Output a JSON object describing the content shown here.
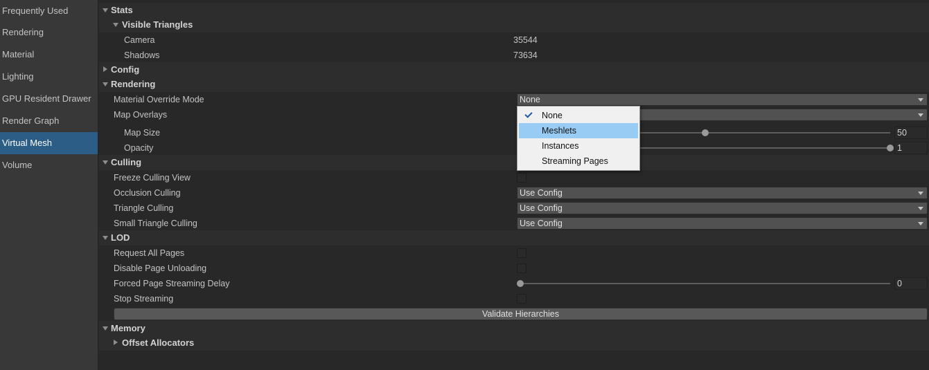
{
  "sidebar": {
    "items": [
      {
        "label": "Frequently Used"
      },
      {
        "label": "Rendering"
      },
      {
        "label": "Material"
      },
      {
        "label": "Lighting"
      },
      {
        "label": "GPU Resident Drawer"
      },
      {
        "label": "Render Graph"
      },
      {
        "label": "Virtual Mesh",
        "selected": true
      },
      {
        "label": "Volume"
      }
    ]
  },
  "stats": {
    "title": "Stats",
    "visible_triangles": {
      "title": "Visible Triangles",
      "camera_label": "Camera",
      "camera_value": "35544",
      "shadows_label": "Shadows",
      "shadows_value": "73634"
    }
  },
  "config": {
    "title": "Config"
  },
  "rendering": {
    "title": "Rendering",
    "material_override_mode": {
      "label": "Material Override Mode",
      "value": "None"
    },
    "map_overlays": {
      "label": "Map Overlays",
      "value": ""
    },
    "map_size": {
      "label": "Map Size",
      "value": "50",
      "fraction": 0.5
    },
    "opacity": {
      "label": "Opacity",
      "value": "1",
      "fraction": 1.0
    }
  },
  "culling": {
    "title": "Culling",
    "freeze_culling_view": {
      "label": "Freeze Culling View",
      "checked": false
    },
    "occlusion_culling": {
      "label": "Occlusion Culling",
      "value": "Use Config"
    },
    "triangle_culling": {
      "label": "Triangle Culling",
      "value": "Use Config"
    },
    "small_triangle_culling": {
      "label": "Small Triangle Culling",
      "value": "Use Config"
    }
  },
  "lod": {
    "title": "LOD",
    "request_all_pages": {
      "label": "Request All Pages",
      "checked": false
    },
    "disable_page_unloading": {
      "label": "Disable Page Unloading",
      "checked": false
    },
    "forced_page_streaming_delay": {
      "label": "Forced Page Streaming Delay",
      "value": "0",
      "fraction": 0.0
    },
    "stop_streaming": {
      "label": "Stop Streaming",
      "checked": false
    },
    "validate_button": "Validate Hierarchies"
  },
  "memory": {
    "title": "Memory",
    "offset_allocators": {
      "title": "Offset Allocators"
    }
  },
  "popup": {
    "options": [
      {
        "label": "None",
        "checked": true
      },
      {
        "label": "Meshlets",
        "highlighted": true
      },
      {
        "label": "Instances"
      },
      {
        "label": "Streaming Pages"
      }
    ]
  },
  "colors": {
    "selection": "#2c5d87",
    "popup_highlight": "#99ccf5",
    "background": "#282828"
  }
}
